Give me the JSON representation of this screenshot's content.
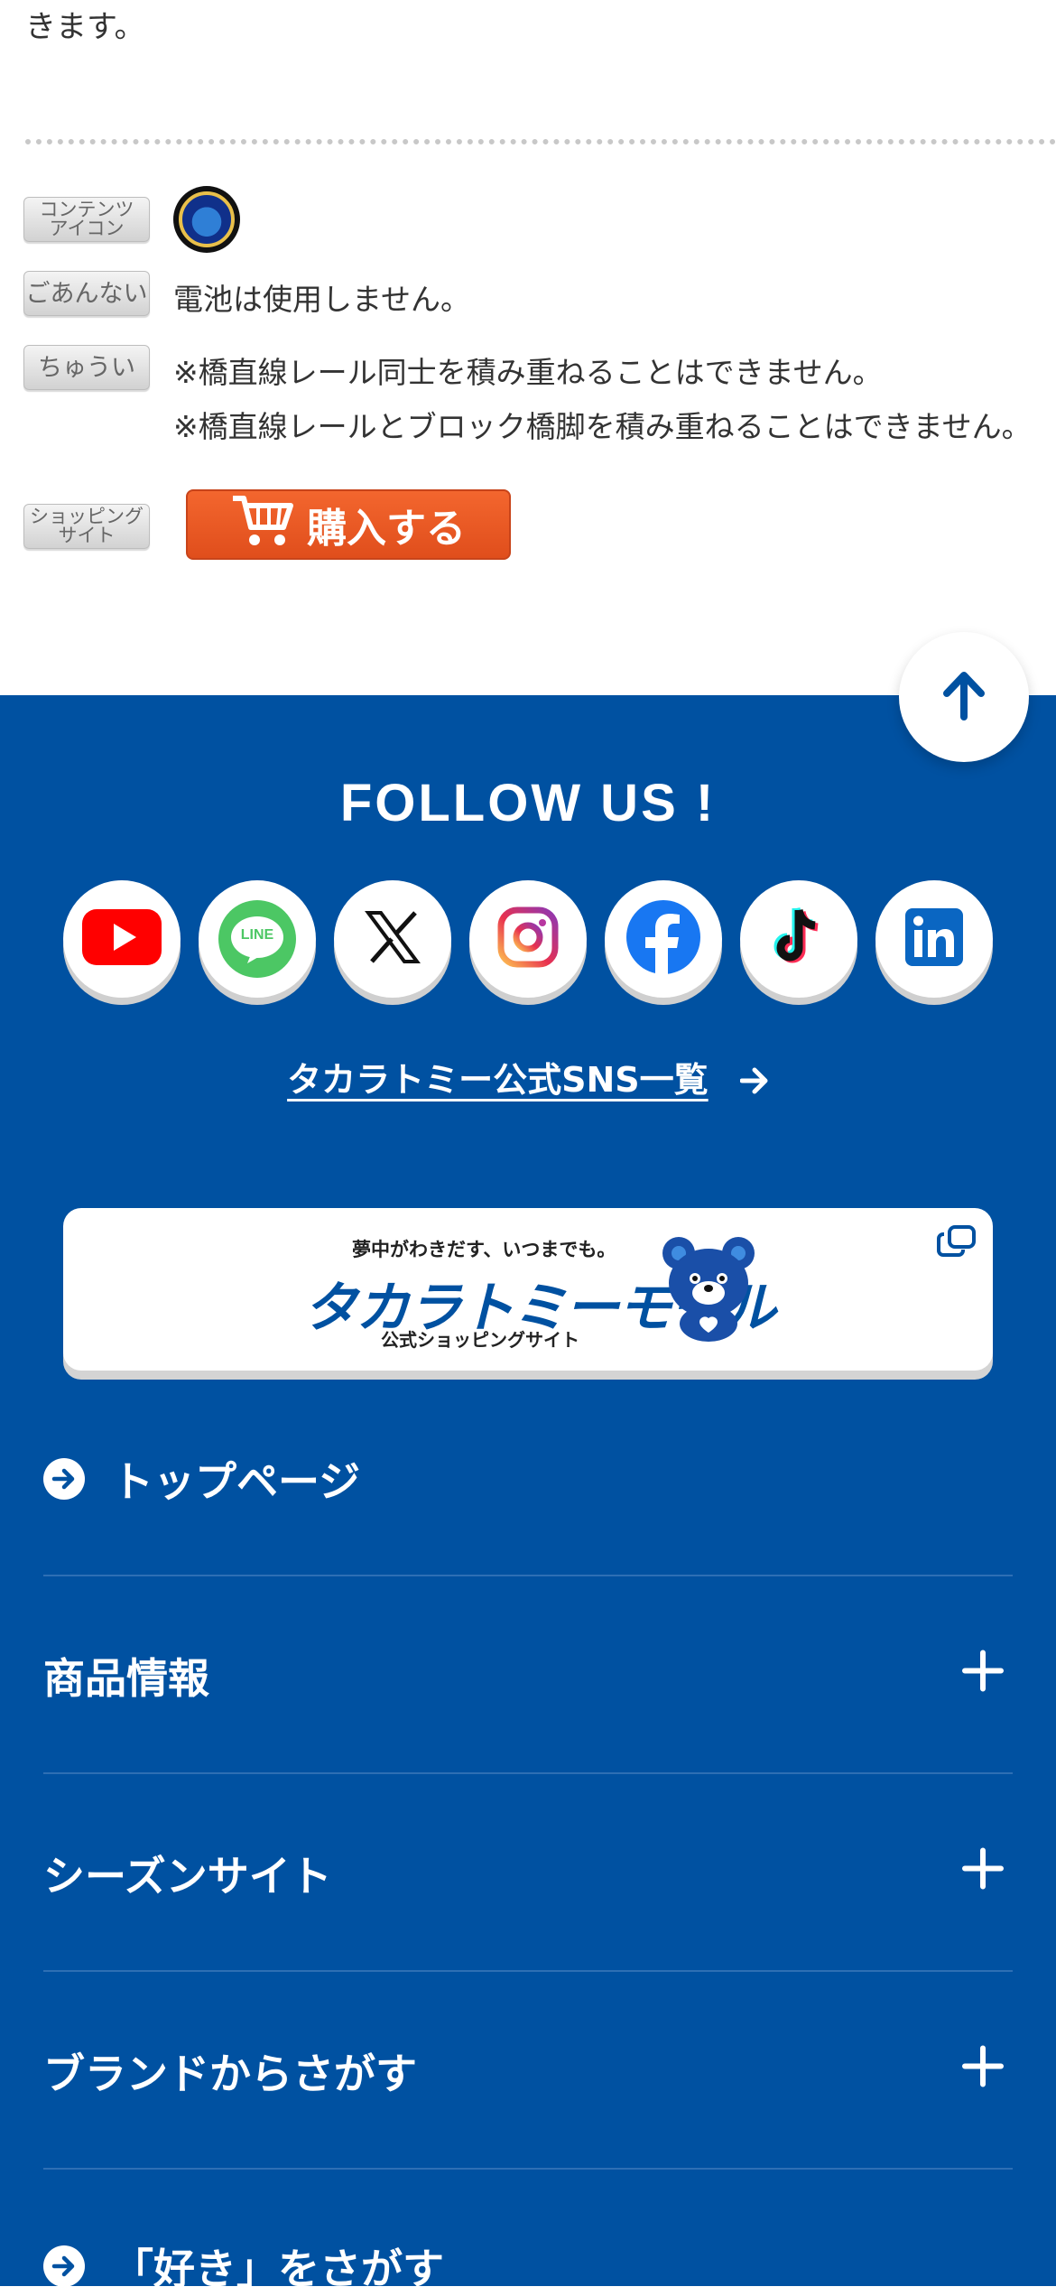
{
  "intro_text_tail": "きます。",
  "spec": {
    "content_icon_label": "コンテンツ\nアイコン",
    "guide_label": "ごあんない",
    "guide_text": "電池は使用しません。",
    "caution_label": "ちゅうい",
    "caution_lines": [
      "※橋直線レール同士を積み重ねることはできません。",
      "※橋直線レールとブロック橋脚を積み重ねることはできません。"
    ],
    "shopping_label": "ショッピング\nサイト",
    "buy_button_label": "購入する"
  },
  "footer": {
    "follow_title": "FOLLOW US !",
    "sns_icons": [
      "youtube-icon",
      "line-icon",
      "x-icon",
      "instagram-icon",
      "facebook-icon",
      "tiktok-icon",
      "linkedin-icon"
    ],
    "line_text": "LINE",
    "sns_list_link": "タカラトミー公式SNS一覧",
    "mall": {
      "tagline": "夢中がわきだす、いつまでも。",
      "title": "タカラトミーモール",
      "subtitle": "公式ショッピングサイト"
    },
    "nav": [
      {
        "label": "トップページ",
        "type": "link"
      },
      {
        "label": "商品情報",
        "type": "expand"
      },
      {
        "label": "シーズンサイト",
        "type": "expand"
      },
      {
        "label": "ブランドからさがす",
        "type": "expand"
      },
      {
        "label": "「好き」をさがす",
        "type": "link"
      }
    ]
  },
  "colors": {
    "footer_blue": "#0051a1",
    "buy_orange": "#e8551f"
  }
}
